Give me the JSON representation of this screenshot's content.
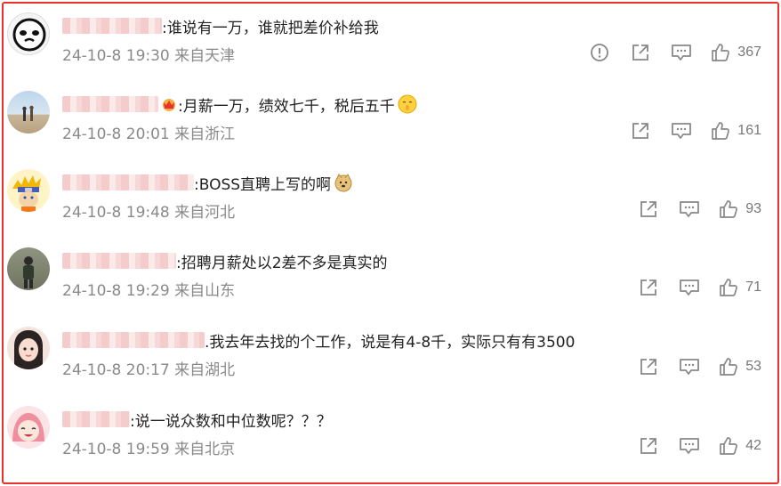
{
  "comments": [
    {
      "text": ":谁说有一万，谁就把差价补给我",
      "date": "24-10-8 19:30",
      "location": "来自天津",
      "likes": "367",
      "avatar": "cartoon-face"
    },
    {
      "text": " :月薪一万，绩效七千，税后五千",
      "date": "24-10-8 20:01",
      "location": "来自浙江",
      "likes": "161",
      "avatar": "beach-couple"
    },
    {
      "text": ":BOSS直聘上写的啊",
      "date": "24-10-8 19:48",
      "location": "来自河北",
      "likes": "93",
      "avatar": "anime-ninja"
    },
    {
      "text": ":招聘月薪处以2差不多是真实的",
      "date": "24-10-8 19:29",
      "location": "来自山东",
      "likes": "71",
      "avatar": "person-photo"
    },
    {
      "text": ".我去年去找的个工作，说是有4-8千，实际只有有3500",
      "date": "24-10-8 20:17",
      "location": "来自湖北",
      "likes": "53",
      "avatar": "girl-photo"
    },
    {
      "text": ":说一说众数和中位数呢？？？",
      "date": "24-10-8 19:59",
      "location": "来自北京",
      "likes": "42",
      "avatar": "pink-hair-character"
    }
  ],
  "colors": {
    "border": "#e8322b",
    "meta": "#8a8a8a",
    "icon": "#888888"
  },
  "icons": [
    "report-icon",
    "share-icon",
    "comment-icon",
    "like-icon"
  ]
}
